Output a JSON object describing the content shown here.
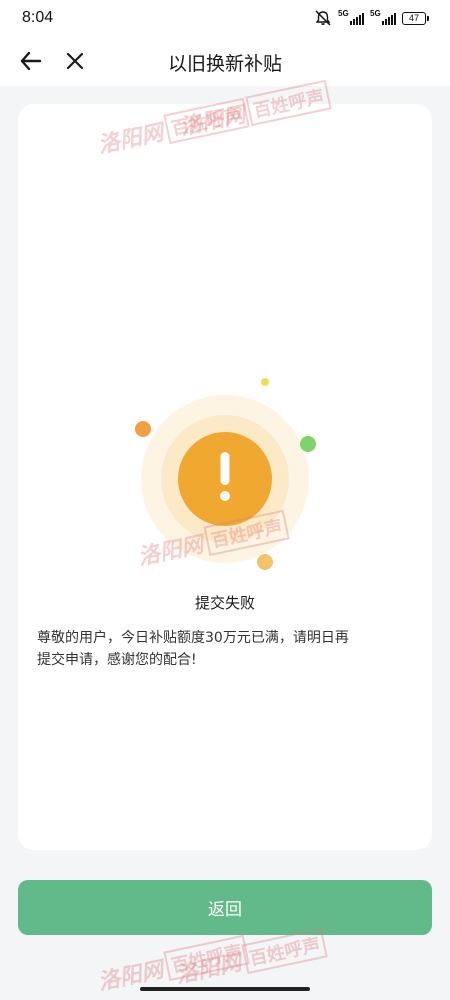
{
  "status_bar": {
    "time": "8:04",
    "network_1": "5G",
    "network_2": "5G",
    "battery": "47"
  },
  "nav": {
    "title": "以旧换新补贴",
    "back_icon": "arrow-left-icon",
    "close_icon": "close-icon"
  },
  "result": {
    "icon": "exclamation-warning-icon",
    "title": "提交失败",
    "message": "尊敬的用户，今日补贴额度30万元已满，请明日再\n提交申请，感谢您的配合!"
  },
  "actions": {
    "return_label": "返回"
  },
  "watermark": {
    "city": "洛阳网",
    "voice": "百姓呼声"
  },
  "colors": {
    "accent_green": "#62b98a",
    "warning_orange": "#f0a830",
    "background": "#f3f5f7"
  }
}
